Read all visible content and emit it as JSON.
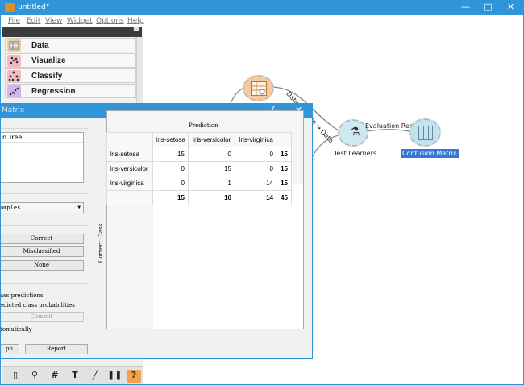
{
  "window": {
    "title": "untitled*",
    "controls": [
      "—",
      "□",
      "✕"
    ]
  },
  "menu": [
    "File",
    "Edit",
    "View",
    "Widget",
    "Options",
    "Help"
  ],
  "toolbox": {
    "categories": [
      {
        "label": "Data",
        "icon": "data-table-icon",
        "color": "#f9c89a"
      },
      {
        "label": "Visualize",
        "icon": "scatter-icon",
        "color": "#f6b9c2"
      },
      {
        "label": "Classify",
        "icon": "tree-icon",
        "color": "#f6b9c2"
      },
      {
        "label": "Regression",
        "icon": "regression-icon",
        "color": "#d3b3f0"
      }
    ],
    "bottom_icons": [
      "document-icon",
      "search-icon",
      "grid-icon",
      "text-icon",
      "pen-icon",
      "pause-icon",
      "help-icon"
    ]
  },
  "canvas": {
    "nodes": {
      "test_learners": "Test Learners",
      "confusion_matrix": "Confusion Matrix"
    },
    "links": {
      "data_sample": "Data Sample → Data",
      "evaluation_results": "Evaluation Results"
    }
  },
  "dialog": {
    "title": "Matrix",
    "help": "?",
    "close": "✕",
    "learner_item": "n Tree",
    "dropdown": "amples",
    "buttons": [
      "Correct",
      "Misclassified",
      "None"
    ],
    "options": [
      "ass predictions",
      "edicted class probabilities",
      "tomatically"
    ],
    "commit": "Commit",
    "bottom_buttons": [
      "ph",
      "Report"
    ],
    "prediction_label": "Prediction",
    "correct_class_label": "Correct Class"
  },
  "chart_data": {
    "type": "table",
    "columns": [
      "Iris-setosa",
      "Iris-versicolor",
      "Iris-virginica"
    ],
    "rows": [
      {
        "label": "Iris-setosa",
        "values": [
          "15",
          "0",
          "0"
        ],
        "total": "15"
      },
      {
        "label": "Iris-versicolor",
        "values": [
          "0",
          "15",
          "0"
        ],
        "total": "15"
      },
      {
        "label": "Iris-virginica",
        "values": [
          "0",
          "1",
          "14"
        ],
        "total": "15"
      }
    ],
    "column_totals": [
      "15",
      "16",
      "14"
    ],
    "grand_total": "45"
  }
}
